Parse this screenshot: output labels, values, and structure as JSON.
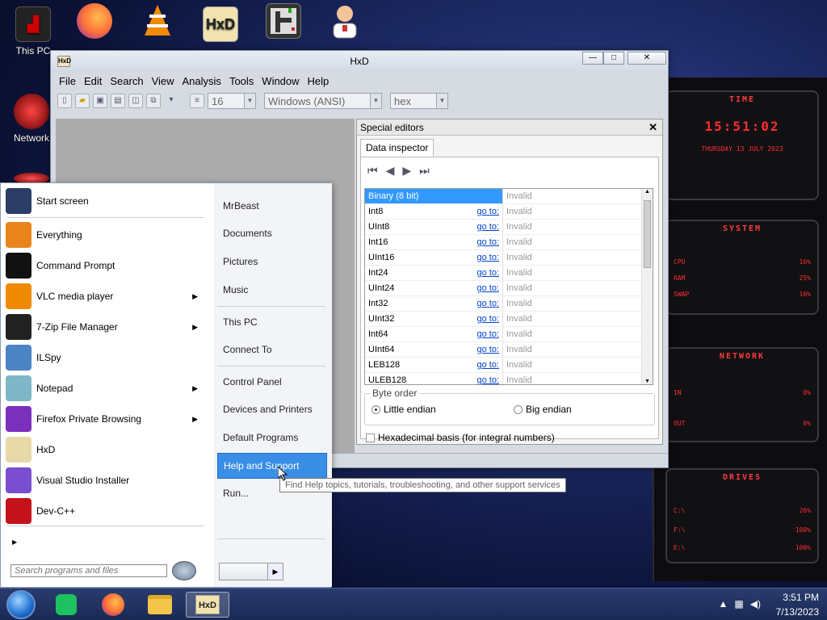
{
  "desktop": {
    "icons": [
      {
        "label": "This PC"
      },
      {
        "label": "Network"
      }
    ]
  },
  "widget": {
    "time_title": "TIME",
    "time": "15:51:02",
    "date": "THURSDAY 13 JULY 2023",
    "system_title": "SYSTEM",
    "system_rows": [
      {
        "label": "CPU",
        "value": "16%"
      },
      {
        "label": "RAM",
        "value": "25%"
      },
      {
        "label": "SWAP",
        "value": "16%"
      }
    ],
    "network_title": "NETWORK",
    "network_rows": [
      {
        "label": "IN",
        "value": "0%"
      },
      {
        "label": "OUT",
        "value": "0%"
      }
    ],
    "drives_title": "DRIVES",
    "drives": [
      {
        "label": "C:\\",
        "value": "26%"
      },
      {
        "label": "F:\\",
        "value": "100%"
      },
      {
        "label": "E:\\",
        "value": "100%"
      }
    ]
  },
  "hxd": {
    "title": "HxD",
    "menu": [
      "File",
      "Edit",
      "Search",
      "View",
      "Analysis",
      "Tools",
      "Window",
      "Help"
    ],
    "toolbar": {
      "bytes_per_row": "16",
      "charset": "Windows (ANSI)",
      "display": "hex"
    },
    "special_editors": {
      "title": "Special editors",
      "tab": "Data inspector",
      "rows": [
        {
          "type": "Binary (8 bit)",
          "goto": "",
          "value": "Invalid"
        },
        {
          "type": "Int8",
          "goto": "go to:",
          "value": "Invalid"
        },
        {
          "type": "UInt8",
          "goto": "go to:",
          "value": "Invalid"
        },
        {
          "type": "Int16",
          "goto": "go to:",
          "value": "Invalid"
        },
        {
          "type": "UInt16",
          "goto": "go to:",
          "value": "Invalid"
        },
        {
          "type": "Int24",
          "goto": "go to:",
          "value": "Invalid"
        },
        {
          "type": "UInt24",
          "goto": "go to:",
          "value": "Invalid"
        },
        {
          "type": "Int32",
          "goto": "go to:",
          "value": "Invalid"
        },
        {
          "type": "UInt32",
          "goto": "go to:",
          "value": "Invalid"
        },
        {
          "type": "Int64",
          "goto": "go to:",
          "value": "Invalid"
        },
        {
          "type": "UInt64",
          "goto": "go to:",
          "value": "Invalid"
        },
        {
          "type": "LEB128",
          "goto": "go to:",
          "value": "Invalid"
        },
        {
          "type": "ULEB128",
          "goto": "go to:",
          "value": "Invalid"
        }
      ],
      "byte_order_label": "Byte order",
      "little_endian": "Little endian",
      "big_endian": "Big endian",
      "hex_basis": "Hexadecimal basis (for integral numbers)"
    }
  },
  "start_menu": {
    "left_items": [
      {
        "label": "Start screen",
        "icon": "start-screen-icon",
        "color": "#2b3d66",
        "sub": false
      },
      {
        "label": "Everything",
        "icon": "magnifier-icon",
        "color": "#e8841a",
        "sub": false
      },
      {
        "label": "Command Prompt",
        "icon": "cmd-icon",
        "color": "#111111",
        "sub": false
      },
      {
        "label": "VLC media player",
        "icon": "vlc-cone-icon",
        "color": "#f08a00",
        "sub": true
      },
      {
        "label": "7-Zip File Manager",
        "icon": "7zip-icon",
        "color": "#222222",
        "sub": true
      },
      {
        "label": "ILSpy",
        "icon": "ilspy-icon",
        "color": "#4c84c4",
        "sub": false
      },
      {
        "label": "Notepad",
        "icon": "notepad-icon",
        "color": "#7fb6c8",
        "sub": true
      },
      {
        "label": "Firefox Private Browsing",
        "icon": "firefox-private-icon",
        "color": "#7b2fbd",
        "sub": true
      },
      {
        "label": "HxD",
        "icon": "hxd-icon",
        "color": "#e8d9a8",
        "sub": false
      },
      {
        "label": "Visual Studio Installer",
        "icon": "vs-installer-icon",
        "color": "#7a4fcf",
        "sub": false
      },
      {
        "label": "Dev-C++",
        "icon": "devcpp-icon",
        "color": "#c4121a",
        "sub": false
      }
    ],
    "right_items": [
      "MrBeast",
      "Documents",
      "Pictures",
      "Music",
      "This PC",
      "Connect To",
      "Control Panel",
      "Devices and Printers",
      "Default Programs",
      "Help and Support",
      "Run..."
    ],
    "search_placeholder": "Search programs and files",
    "tooltip": "Find Help topics, tutorials, troubleshooting, and other support services"
  },
  "taskbar": {
    "time": "3:51 PM",
    "date": "7/13/2023"
  }
}
